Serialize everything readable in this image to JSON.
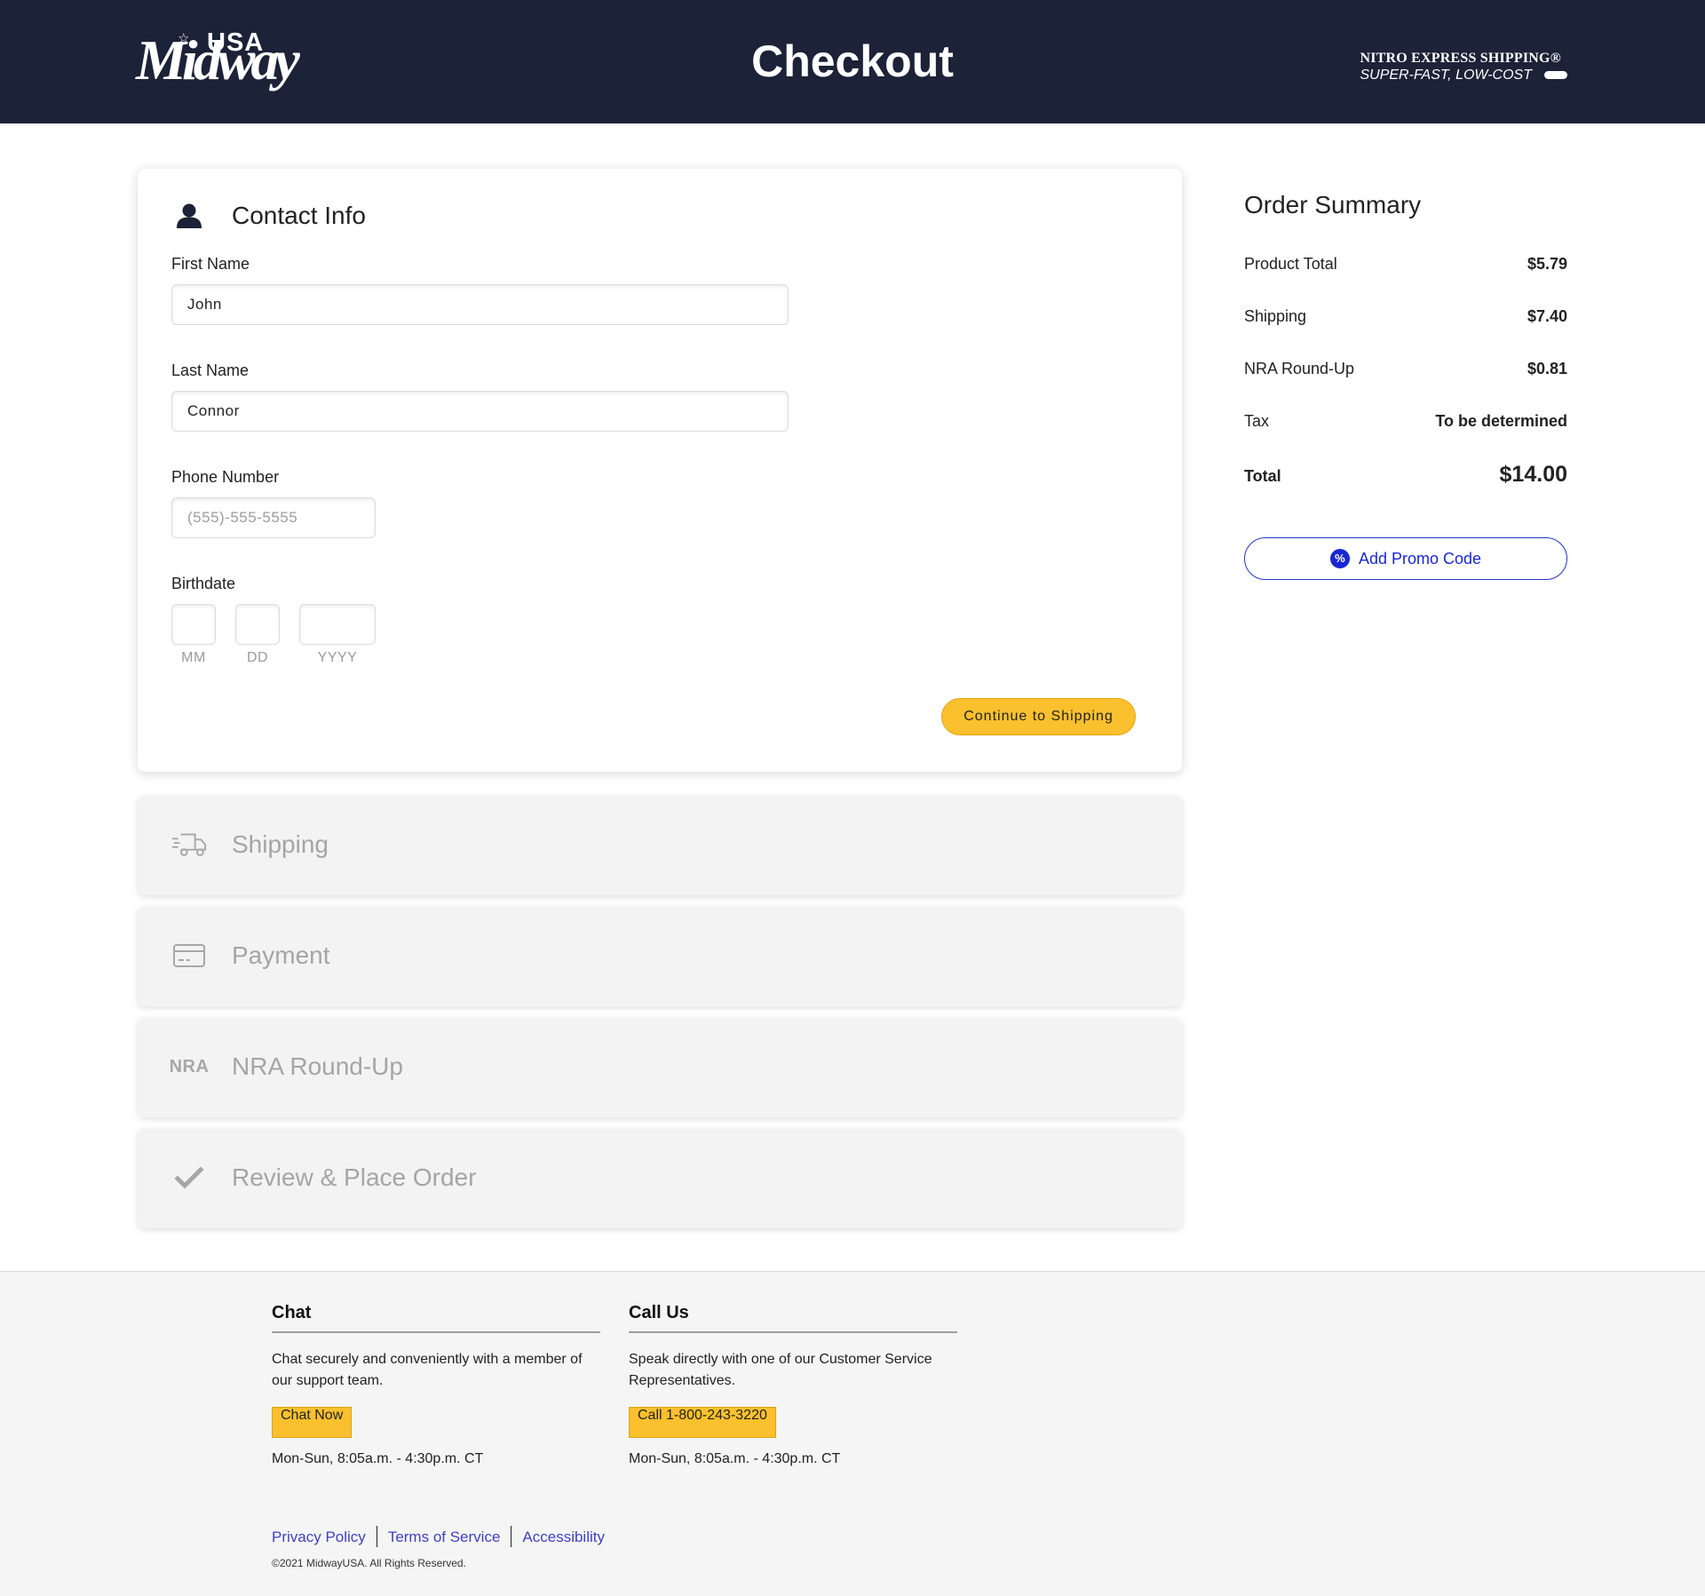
{
  "header": {
    "logo_usa": "USA",
    "logo_name": "Midway",
    "title": "Checkout",
    "promo_line1": "NITRO EXPRESS SHIPPING®",
    "promo_line2": "SUPER-FAST, LOW-COST"
  },
  "contact": {
    "title": "Contact Info",
    "first_name_label": "First Name",
    "first_name_value": "John",
    "last_name_label": "Last Name",
    "last_name_value": "Connor",
    "phone_label": "Phone Number",
    "phone_placeholder": "(555)-555-5555",
    "birthdate_label": "Birthdate",
    "mm": "MM",
    "dd": "DD",
    "yyyy": "YYYY",
    "continue_label": "Continue to Shipping"
  },
  "steps": {
    "shipping": "Shipping",
    "payment": "Payment",
    "nra_icon_text": "NRA",
    "nra": "NRA Round-Up",
    "review": "Review & Place Order"
  },
  "summary": {
    "title": "Order Summary",
    "rows": [
      {
        "label": "Product Total",
        "value": "$5.79"
      },
      {
        "label": "Shipping",
        "value": "$7.40"
      },
      {
        "label": "NRA Round-Up",
        "value": "$0.81"
      },
      {
        "label": "Tax",
        "value": "To be determined"
      }
    ],
    "total_label": "Total",
    "total_value": "$14.00",
    "promo_icon": "%",
    "promo_label": "Add Promo Code"
  },
  "footer": {
    "chat_title": "Chat",
    "chat_text": "Chat securely and conveniently with a member of our support team.",
    "chat_button": "Chat Now",
    "chat_hours": "Mon-Sun, 8:05a.m. - 4:30p.m. CT",
    "call_title": "Call Us",
    "call_text": "Speak directly with one of our Customer Service Representatives.",
    "call_button": "Call 1-800-243-3220",
    "call_hours": "Mon-Sun, 8:05a.m. - 4:30p.m. CT",
    "links": [
      "Privacy Policy",
      "Terms of Service",
      "Accessibility"
    ],
    "copyright": "©2021 MidwayUSA. All Rights Reserved."
  },
  "colors": {
    "header_bg": "#1c2237",
    "accent_yellow": "#fbc02d",
    "link_blue": "#1a27d0"
  }
}
